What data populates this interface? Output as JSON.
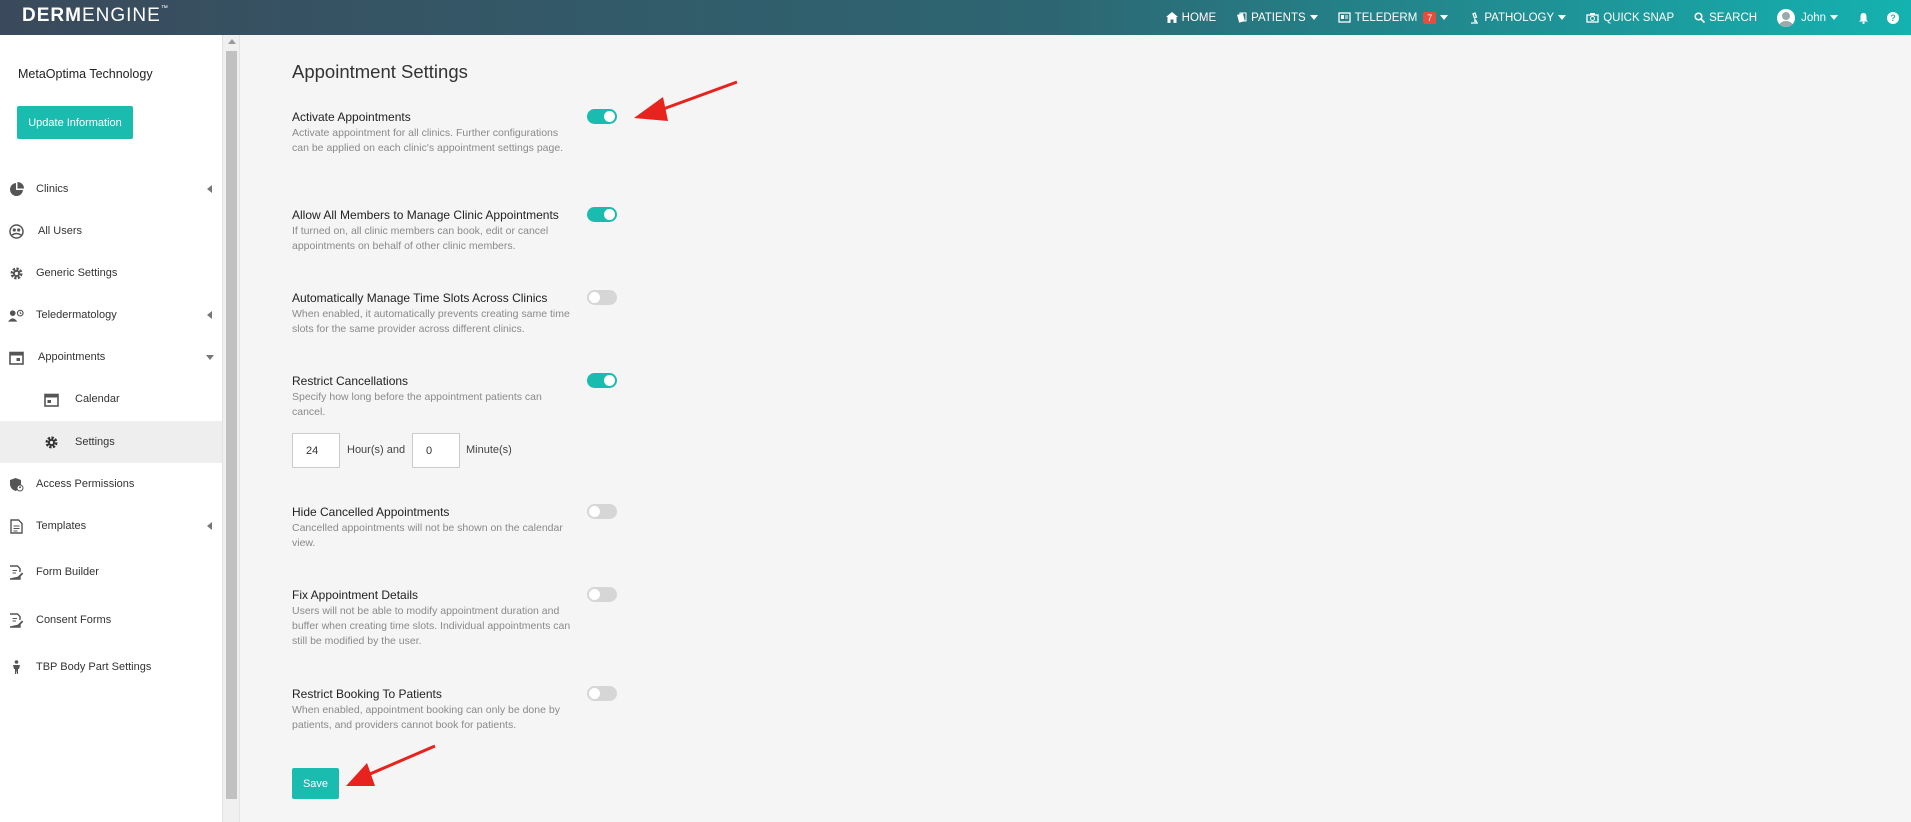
{
  "brand": {
    "logo_bold": "DERM",
    "logo_light": "ENGINE",
    "logo_mark": "™"
  },
  "nav": {
    "home": "HOME",
    "patients": "PATIENTS",
    "telederm": "TELEDERM",
    "telederm_badge": "7",
    "pathology": "PATHOLOGY",
    "quick_snap": "QUICK SNAP",
    "search": "SEARCH",
    "user": "John",
    "help": "?"
  },
  "sidebar": {
    "org_name": "MetaOptima Technology",
    "update_button": "Update Information",
    "items": [
      {
        "label": "Clinics",
        "icon": "pie-chart-icon"
      },
      {
        "label": "All Users",
        "icon": "users-icon"
      },
      {
        "label": "Generic Settings",
        "icon": "gear-icon"
      },
      {
        "label": "Teledermatology",
        "icon": "user-clock-icon"
      },
      {
        "label": "Appointments",
        "icon": "calendar-icon"
      },
      {
        "label": "Calendar",
        "icon": "calendar-day-icon"
      },
      {
        "label": "Settings",
        "icon": "gear-icon"
      },
      {
        "label": "Access Permissions",
        "icon": "shield-user-icon"
      },
      {
        "label": "Templates",
        "icon": "document-icon"
      },
      {
        "label": "Form Builder",
        "icon": "form-edit-icon"
      },
      {
        "label": "Consent Forms",
        "icon": "consent-form-icon"
      },
      {
        "label": "TBP Body Part Settings",
        "icon": "body-figure-icon"
      }
    ]
  },
  "main": {
    "title": "Appointment Settings",
    "settings": [
      {
        "title": "Activate Appointments",
        "desc": "Activate appointment for all clinics. Further configurations can be applied on each clinic's appointment settings page.",
        "enabled": true
      },
      {
        "title": "Allow All Members to Manage Clinic Appointments",
        "desc": "If turned on, all clinic members can book, edit or cancel appointments on behalf of other clinic members.",
        "enabled": true
      },
      {
        "title": "Automatically Manage Time Slots Across Clinics",
        "desc": "When enabled, it automatically prevents creating same time slots for the same provider across different clinics.",
        "enabled": false
      },
      {
        "title": "Restrict Cancellations",
        "desc": "Specify how long before the appointment patients can cancel.",
        "enabled": true
      },
      {
        "title": "Hide Cancelled Appointments",
        "desc": "Cancelled appointments will not be shown on the calendar view.",
        "enabled": false
      },
      {
        "title": "Fix Appointment Details",
        "desc": "Users will not be able to modify appointment duration and buffer when creating time slots. Individual appointments can still be modified by the user.",
        "enabled": false
      },
      {
        "title": "Restrict Booking To Patients",
        "desc": "When enabled, appointment booking can only be done by patients, and providers cannot book for patients.",
        "enabled": false
      }
    ],
    "cancel_hours": "24",
    "hours_label": "Hour(s) and",
    "cancel_minutes": "0",
    "minutes_label": "Minute(s)",
    "save_button": "Save"
  },
  "colors": {
    "accent": "#1bbcb0",
    "annotation_arrow": "#e8221c",
    "badge": "#e74c3c"
  }
}
